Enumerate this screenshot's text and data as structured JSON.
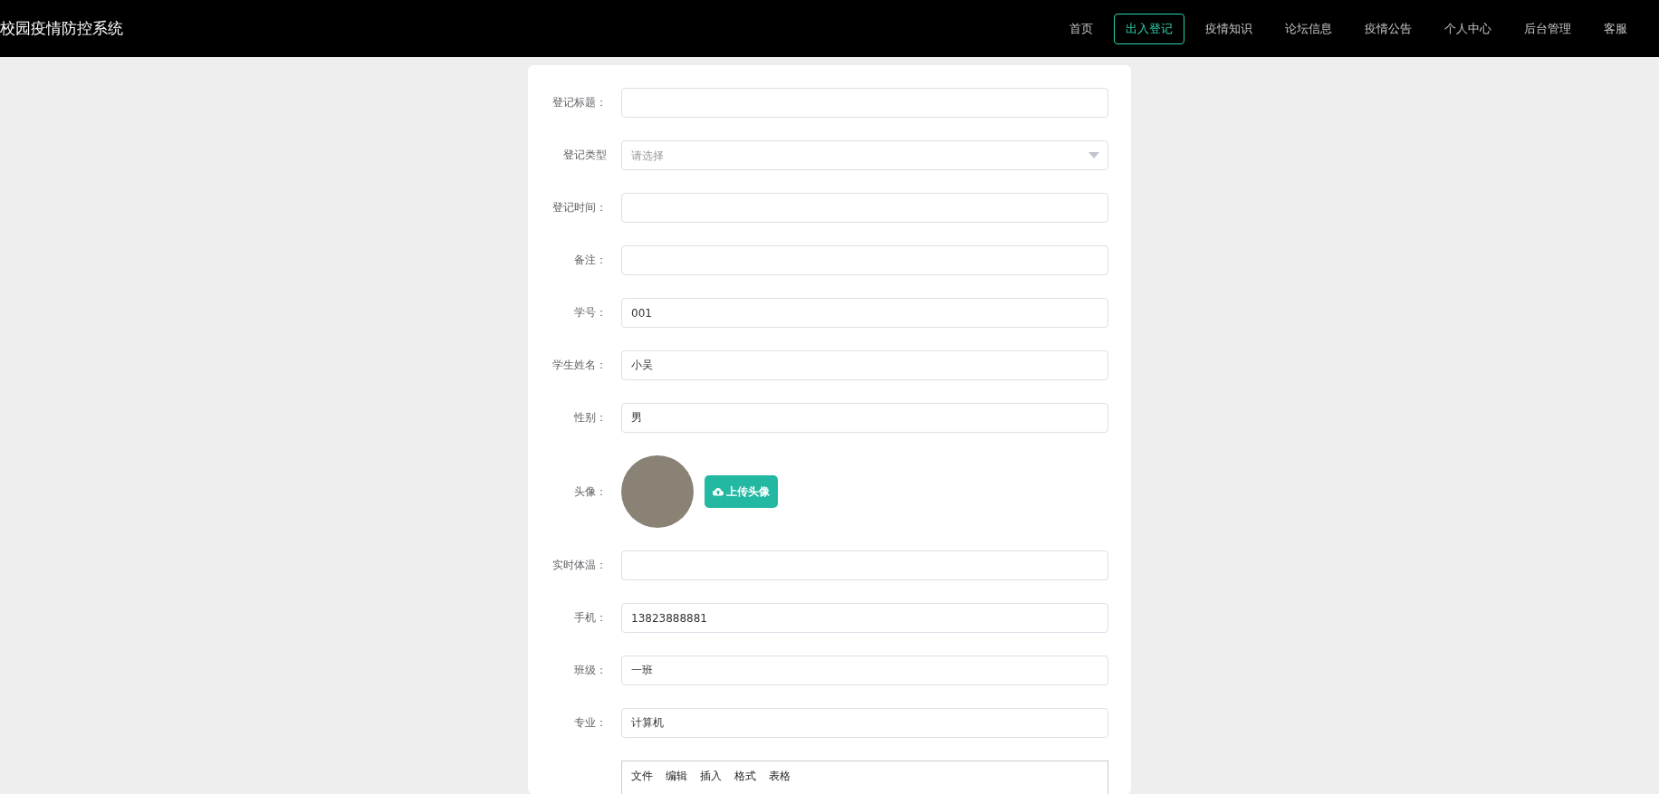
{
  "header": {
    "title": "校园疫情防控系统",
    "nav": [
      {
        "label": "首页",
        "selected": false
      },
      {
        "label": "出入登记",
        "selected": true
      },
      {
        "label": "疫情知识",
        "selected": false
      },
      {
        "label": "论坛信息",
        "selected": false
      },
      {
        "label": "疫情公告",
        "selected": false
      },
      {
        "label": "个人中心",
        "selected": false
      },
      {
        "label": "后台管理",
        "selected": false
      },
      {
        "label": "客服",
        "selected": false
      }
    ]
  },
  "form": {
    "fields": [
      {
        "kind": "text",
        "label": "登记标题："
      },
      {
        "kind": "select",
        "label": "登记类型",
        "placeholder": "请选择"
      },
      {
        "kind": "text",
        "label": "登记时间："
      },
      {
        "kind": "text",
        "label": "备注："
      },
      {
        "kind": "text",
        "label": "学号：",
        "value": "001"
      },
      {
        "kind": "text",
        "label": "学生姓名：",
        "value": "小吴"
      },
      {
        "kind": "text",
        "label": "性别：",
        "value": "男"
      },
      {
        "kind": "avatar",
        "label": "头像：",
        "button": "上传头像"
      },
      {
        "kind": "text",
        "label": "实时体温："
      },
      {
        "kind": "text",
        "label": "手机：",
        "value": "13823888881"
      },
      {
        "kind": "text",
        "label": "班级：",
        "value": "一班"
      },
      {
        "kind": "text",
        "label": "专业：",
        "value": "计算机"
      },
      {
        "kind": "editor",
        "menu": [
          "文件",
          "编辑",
          "插入",
          "格式",
          "表格"
        ]
      }
    ]
  }
}
